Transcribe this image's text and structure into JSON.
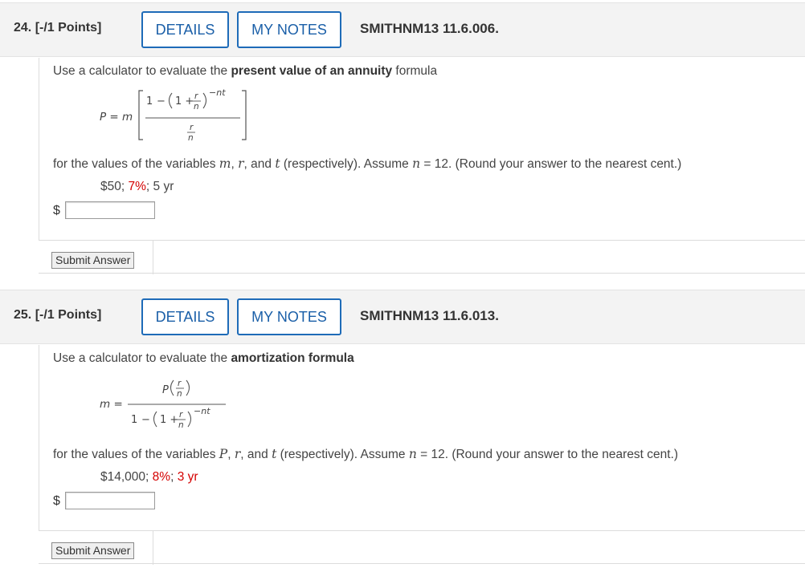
{
  "questions": [
    {
      "number_label": "24. [-/1 Points]",
      "details_label": "DETAILS",
      "notes_label": "MY NOTES",
      "code": "SMITHNM13 11.6.006.",
      "prompt_prefix": "Use a calculator to evaluate the ",
      "prompt_bold": "present value of an annuity",
      "prompt_suffix": " formula",
      "formula": {
        "lhs": "P = m",
        "one": "1",
        "minus": "−",
        "inner_one": "1 +",
        "r": "r",
        "n": "n",
        "exponent": "−nt"
      },
      "instructions": {
        "part1": "for the values of the variables ",
        "var1": "m",
        "sep1": ", ",
        "var2": "r",
        "sep2": ", and ",
        "var3": "t",
        "part2": " (respectively). Assume ",
        "n_var": "n",
        "part3": " = 12. (Round your answer to the nearest cent.)"
      },
      "values": {
        "v1": "$50",
        "sep1": "; ",
        "v2": "7%",
        "sep2": "; ",
        "v3": "5 yr"
      },
      "currency_symbol": "$",
      "answer_value": "",
      "submit_label": "Submit Answer"
    },
    {
      "number_label": "25. [-/1 Points]",
      "details_label": "DETAILS",
      "notes_label": "MY NOTES",
      "code": "SMITHNM13 11.6.013.",
      "prompt_prefix": "Use a calculator to evaluate the ",
      "prompt_bold": "amortization formula",
      "prompt_suffix": "",
      "formula": {
        "lhs": "m =",
        "P": "P",
        "r": "r",
        "n": "n",
        "one": "1",
        "minus": "−",
        "inner_one": "1 +",
        "exponent": "−nt"
      },
      "instructions": {
        "part1": "for the values of the variables ",
        "var1": "P",
        "sep1": ", ",
        "var2": "r",
        "sep2": ", and ",
        "var3": "t",
        "part2": " (respectively). Assume ",
        "n_var": "n",
        "part3": " = 12. (Round your answer to the nearest cent.)"
      },
      "values": {
        "v1": "$14,000",
        "sep1": "; ",
        "v2": "8%",
        "sep2": "; ",
        "v3": "3 yr"
      },
      "currency_symbol": "$",
      "answer_value": "",
      "submit_label": "Submit Answer"
    }
  ],
  "colors": {
    "accent": "#1e6bb8",
    "highlight_red": "#d40000",
    "header_bg": "#f3f3f3"
  }
}
